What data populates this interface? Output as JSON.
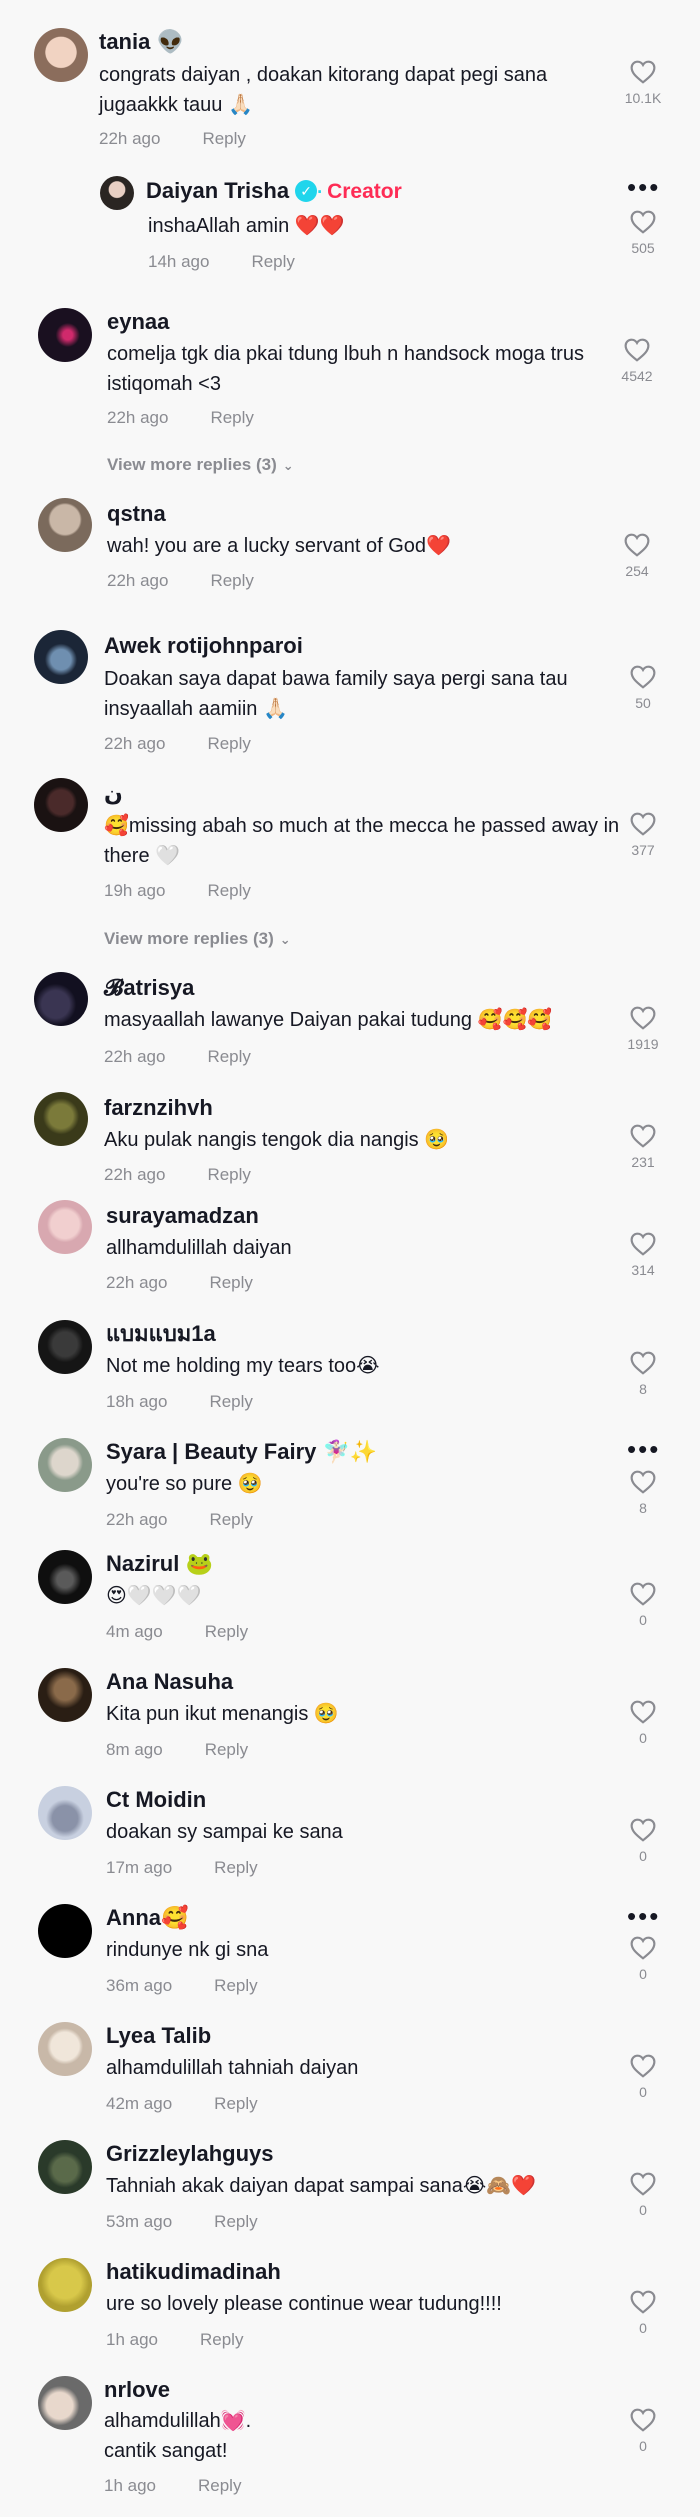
{
  "icons": {
    "like": "heart-outline-icon",
    "more": "more-dots-icon",
    "verified": "verified-check-icon",
    "chevron": "chevron-down-icon"
  },
  "comments": [
    {
      "user": "tania 👽",
      "text": "congrats daiyan , doakan kitorang dapat pegi sana jugaakkk tauu 🙏🏻",
      "time": "22h ago",
      "reply": "Reply",
      "likes": "10.1K"
    },
    {
      "user": "Daiyan Trisha",
      "badge": "Creator",
      "text": "inshaAllah amin ❤️❤️",
      "time": "14h ago",
      "reply": "Reply",
      "likes": "505"
    },
    {
      "user": "eynaa",
      "text": "comelja tgk dia pkai tdung lbuh n handsock moga trus istiqomah <3",
      "time": "22h ago",
      "reply": "Reply",
      "likes": "4542",
      "view_more": "View more replies (3)"
    },
    {
      "user": "qstna",
      "text": "wah! you are a lucky servant of God❤️",
      "time": "22h ago",
      "reply": "Reply",
      "likes": "254"
    },
    {
      "user": "Awek rotijohnparoi",
      "text": "Doakan saya dapat bawa family saya pergi sana tau insyaallah aamiin 🙏🏻",
      "time": "22h ago",
      "reply": "Reply",
      "likes": "50"
    },
    {
      "user": "ن",
      "text": "🥰missing abah so much at the mecca he passed away in there 🤍",
      "time": "19h ago",
      "reply": "Reply",
      "likes": "377",
      "view_more": "View more replies (3)"
    },
    {
      "user": "𝓑atrisya",
      "text": "masyaallah lawanye Daiyan pakai tudung 🥰🥰🥰",
      "time": "22h ago",
      "reply": "Reply",
      "likes": "1919"
    },
    {
      "user": "farznzihvh",
      "text": "Aku pulak nangis tengok dia nangis 🥹",
      "time": "22h ago",
      "reply": "Reply",
      "likes": "231"
    },
    {
      "user": "surayamadzan",
      "text": "allhamdulillah daiyan",
      "time": "22h ago",
      "reply": "Reply",
      "likes": "314"
    },
    {
      "user": "แบมแบม1a",
      "text": "Not me holding my tears too😭",
      "time": "18h ago",
      "reply": "Reply",
      "likes": "8"
    },
    {
      "user": "Syara | Beauty Fairy 🧚🏻‍♀️✨",
      "text": "you're so pure 🥹",
      "time": "22h ago",
      "reply": "Reply",
      "likes": "8"
    },
    {
      "user": "Nazirul 🐸",
      "text": "😍🤍🤍🤍",
      "time": "4m ago",
      "reply": "Reply",
      "likes": "0"
    },
    {
      "user": "Ana Nasuha",
      "text": "Kita pun ikut menangis 🥹",
      "time": "8m ago",
      "reply": "Reply",
      "likes": "0"
    },
    {
      "user": "Ct Moidin",
      "text": "doakan sy sampai ke sana",
      "time": "17m ago",
      "reply": "Reply",
      "likes": "0"
    },
    {
      "user": "Anna🥰",
      "text": "rindunye nk gi sna",
      "time": "36m ago",
      "reply": "Reply",
      "likes": "0"
    },
    {
      "user": "Lyea Talib",
      "text": "alhamdulillah tahniah daiyan",
      "time": "42m ago",
      "reply": "Reply",
      "likes": "0"
    },
    {
      "user": "Grizzleylahguys",
      "text": "Tahniah akak daiyan dapat sampai sana😭🙈❤️",
      "time": "53m ago",
      "reply": "Reply",
      "likes": "0"
    },
    {
      "user": "hatikudimadinah",
      "text": "ure so lovely please continue wear tudung!!!!",
      "time": "1h ago",
      "reply": "Reply",
      "likes": "0"
    },
    {
      "user": "nrlove",
      "text": "alhamdulillah💓.\ncantik sangat!",
      "time": "1h ago",
      "reply": "Reply",
      "likes": "0"
    }
  ]
}
